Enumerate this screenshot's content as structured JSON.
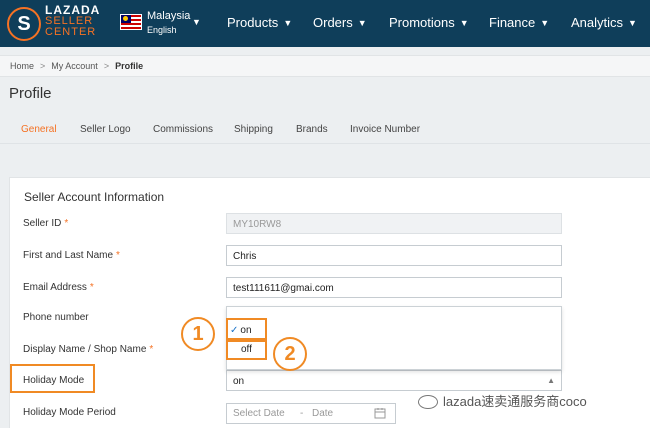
{
  "brand": {
    "line1": "LAZADA",
    "line2": "SELLER",
    "line3": "CENTER",
    "glyph": "S",
    "accent": "#f57224",
    "nav_bg": "#0f3e5a"
  },
  "locale": {
    "country": "Malaysia",
    "language": "English"
  },
  "nav": {
    "items": [
      {
        "label": "Products"
      },
      {
        "label": "Orders"
      },
      {
        "label": "Promotions"
      },
      {
        "label": "Finance"
      },
      {
        "label": "Analytics"
      }
    ]
  },
  "breadcrumb": {
    "items": [
      "Home",
      "My Account",
      "Profile"
    ]
  },
  "page": {
    "title": "Profile"
  },
  "tabs": [
    {
      "label": "General",
      "active": true
    },
    {
      "label": "Seller Logo"
    },
    {
      "label": "Commissions"
    },
    {
      "label": "Shipping"
    },
    {
      "label": "Brands"
    },
    {
      "label": "Invoice Number"
    }
  ],
  "form": {
    "section_title": "Seller Account Information",
    "required_mark": "*",
    "seller_id": {
      "label": "Seller ID",
      "value": "MY10RW8"
    },
    "name": {
      "label": "First and Last Name",
      "value": "Chris"
    },
    "email": {
      "label": "Email Address",
      "value": "test111611@gmai.com"
    },
    "phone": {
      "label": "Phone number"
    },
    "display_name": {
      "label": "Display Name / Shop Name"
    },
    "holiday_mode": {
      "label": "Holiday Mode",
      "value": "on",
      "options": [
        "on",
        "off"
      ]
    },
    "holiday_period": {
      "label": "Holiday Mode Period",
      "start_placeholder": "Select Date",
      "separator": "-",
      "end_placeholder": "Date"
    }
  },
  "annotations": {
    "step1": "1",
    "step2": "2",
    "color": "#f08a24"
  },
  "watermark": {
    "text": "lazada速卖通服务商coco"
  }
}
